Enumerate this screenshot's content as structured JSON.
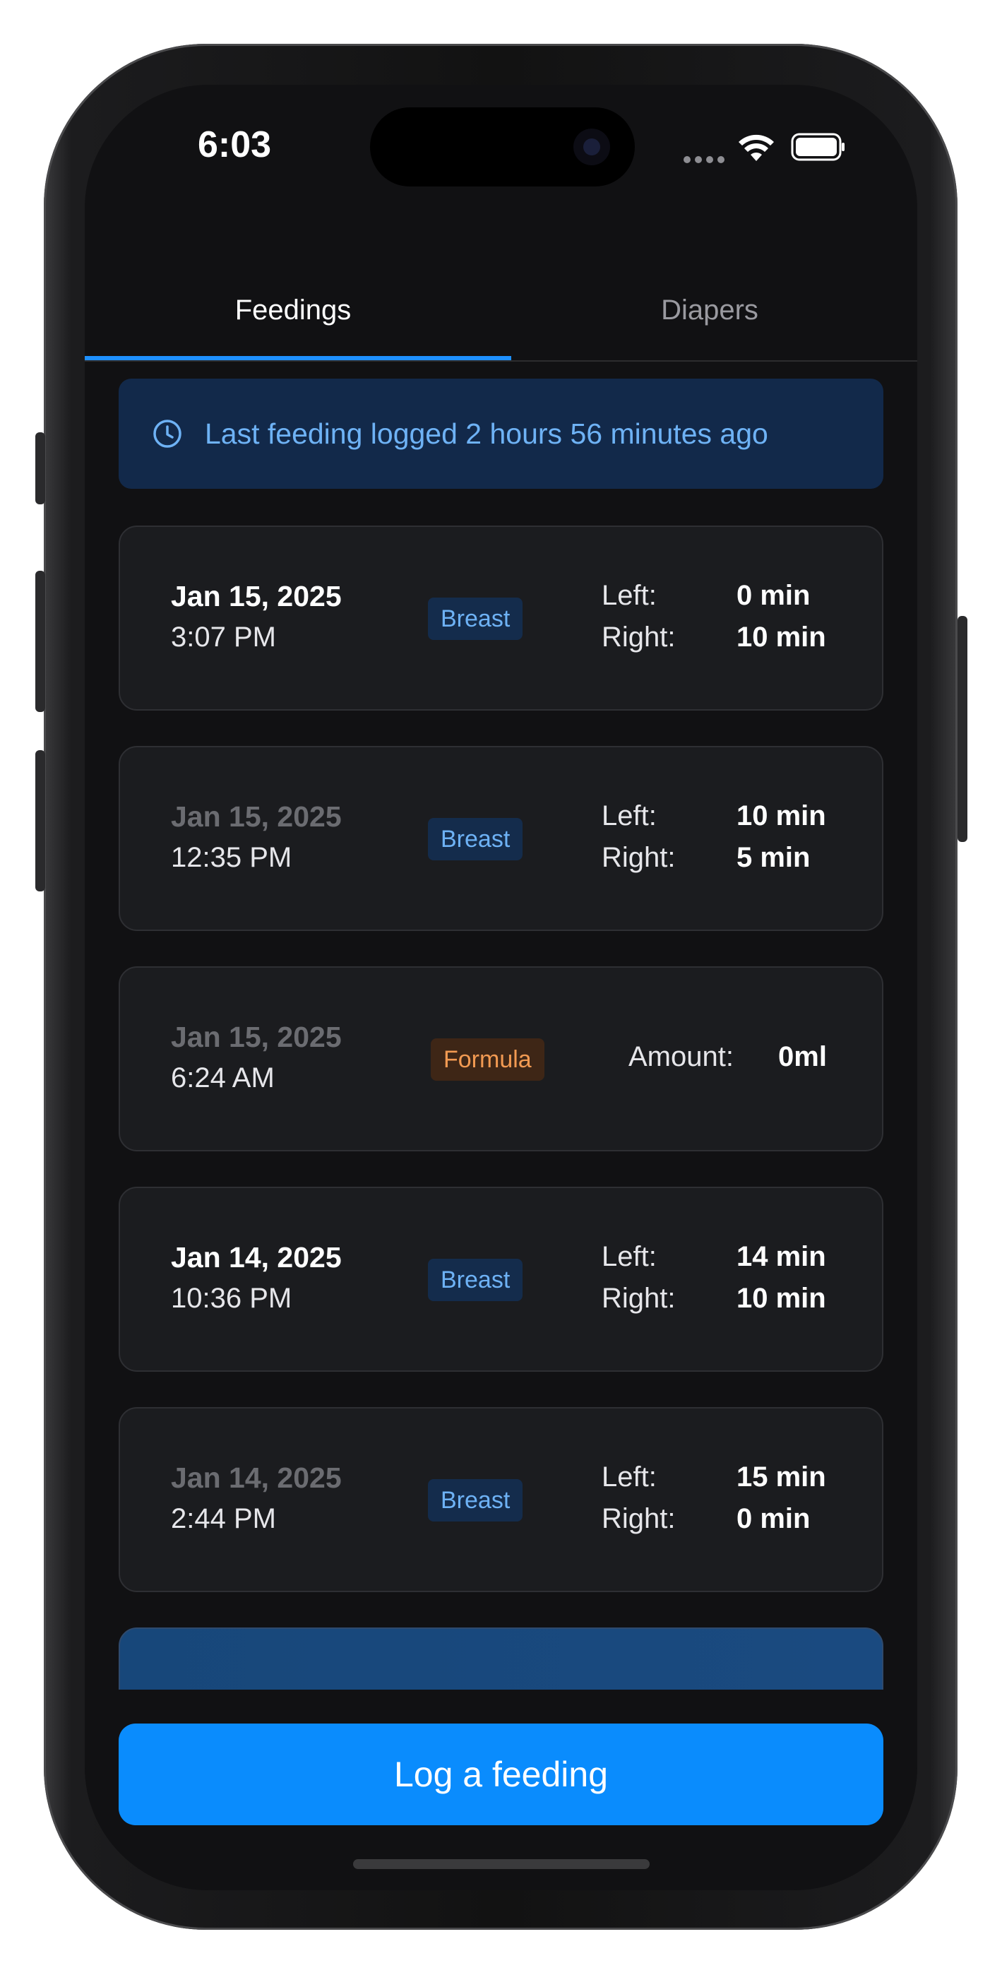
{
  "status_bar": {
    "time": "6:03"
  },
  "tabs": [
    {
      "label": "Feedings",
      "active": true
    },
    {
      "label": "Diapers",
      "active": false
    }
  ],
  "banner": {
    "icon": "clock-icon",
    "text": "Last feeding logged 2 hours 56 minutes ago"
  },
  "feedings": [
    {
      "date": "Jan 15, 2025",
      "time": "3:07 PM",
      "type": "Breast",
      "left_label": "Left:",
      "left": "0 min",
      "right_label": "Right:",
      "right": "10 min"
    },
    {
      "date": "Jan 15, 2025",
      "time": "12:35 PM",
      "type": "Breast",
      "left_label": "Left:",
      "left": "10 min",
      "right_label": "Right:",
      "right": "5 min"
    },
    {
      "date": "Jan 15, 2025",
      "time": "6:24 AM",
      "type": "Formula",
      "amount_label": "Amount:",
      "amount": "0ml"
    },
    {
      "date": "Jan 14, 2025",
      "time": "10:36 PM",
      "type": "Breast",
      "left_label": "Left:",
      "left": "14 min",
      "right_label": "Right:",
      "right": "10 min"
    },
    {
      "date": "Jan 14, 2025",
      "time": "2:44 PM",
      "type": "Breast",
      "left_label": "Left:",
      "left": "15 min",
      "right_label": "Right:",
      "right": "0 min"
    }
  ],
  "actions": {
    "log_feeding": "Log a feeding"
  },
  "colors": {
    "accent": "#0a8cfd",
    "breast_badge": "#6eb2f5",
    "formula_badge": "#f29a52",
    "background": "#111113"
  }
}
